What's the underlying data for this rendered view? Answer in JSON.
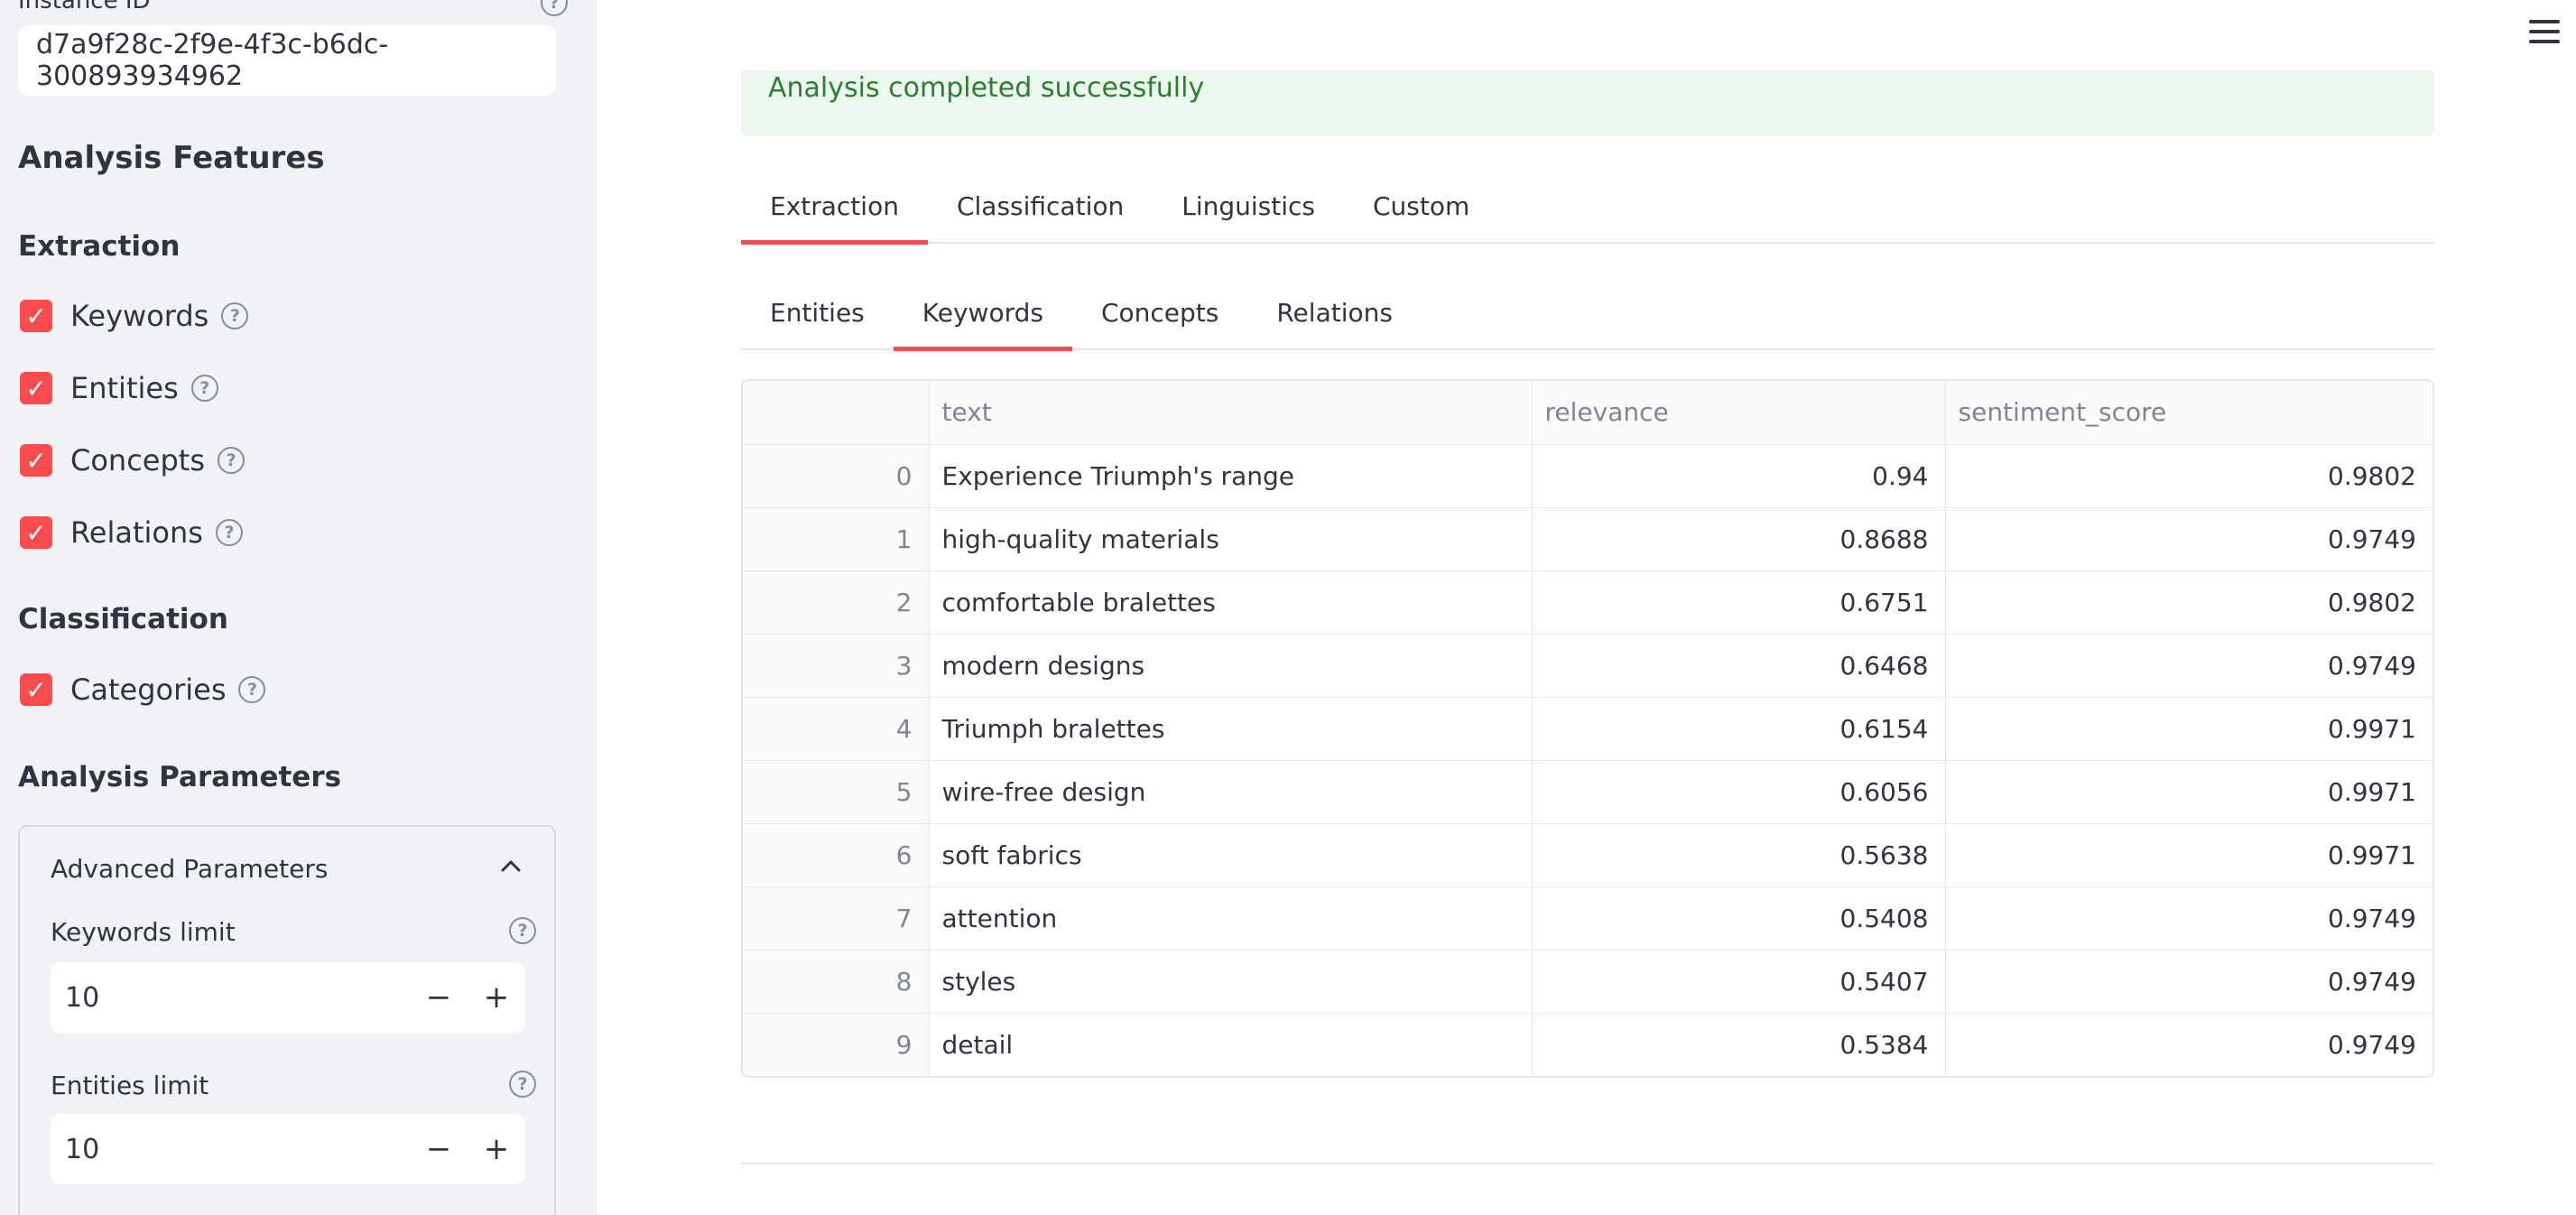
{
  "sidebar": {
    "instance_label": "Instance ID",
    "instance_value": "d7a9f28c-2f9e-4f3c-b6dc-300893934962",
    "features_heading": "Analysis Features",
    "extraction_heading": "Extraction",
    "extraction_items": [
      {
        "label": "Keywords",
        "checked": true
      },
      {
        "label": "Entities",
        "checked": true
      },
      {
        "label": "Concepts",
        "checked": true
      },
      {
        "label": "Relations",
        "checked": true
      }
    ],
    "classification_heading": "Classification",
    "classification_items": [
      {
        "label": "Categories",
        "checked": true
      }
    ],
    "params_heading": "Analysis Parameters",
    "advanced": {
      "title": "Advanced Parameters",
      "keywords_limit_label": "Keywords limit",
      "keywords_limit_value": "10",
      "entities_limit_label": "Entities limit",
      "entities_limit_value": "10"
    }
  },
  "main": {
    "success_message": "Analysis completed successfully",
    "tabs": [
      "Extraction",
      "Classification",
      "Linguistics",
      "Custom"
    ],
    "active_tab": "Extraction",
    "subtabs": [
      "Entities",
      "Keywords",
      "Concepts",
      "Relations"
    ],
    "active_subtab": "Keywords",
    "table": {
      "columns": [
        "",
        "text",
        "relevance",
        "sentiment_score"
      ],
      "rows": [
        [
          "0",
          "Experience Triumph's range",
          "0.94",
          "0.9802"
        ],
        [
          "1",
          "high-quality materials",
          "0.8688",
          "0.9749"
        ],
        [
          "2",
          "comfortable bralettes",
          "0.6751",
          "0.9802"
        ],
        [
          "3",
          "modern designs",
          "0.6468",
          "0.9749"
        ],
        [
          "4",
          "Triumph bralettes",
          "0.6154",
          "0.9971"
        ],
        [
          "5",
          "wire-free design",
          "0.6056",
          "0.9971"
        ],
        [
          "6",
          "soft fabrics",
          "0.5638",
          "0.9971"
        ],
        [
          "7",
          "attention",
          "0.5408",
          "0.9749"
        ],
        [
          "8",
          "styles",
          "0.5407",
          "0.9749"
        ],
        [
          "9",
          "detail",
          "0.5384",
          "0.9749"
        ]
      ]
    }
  },
  "colors": {
    "accent": "#ff4b4b",
    "success_bg": "#ecf8ee",
    "success_text": "#2e7d32",
    "sidebar_bg": "#f0f2f6"
  }
}
